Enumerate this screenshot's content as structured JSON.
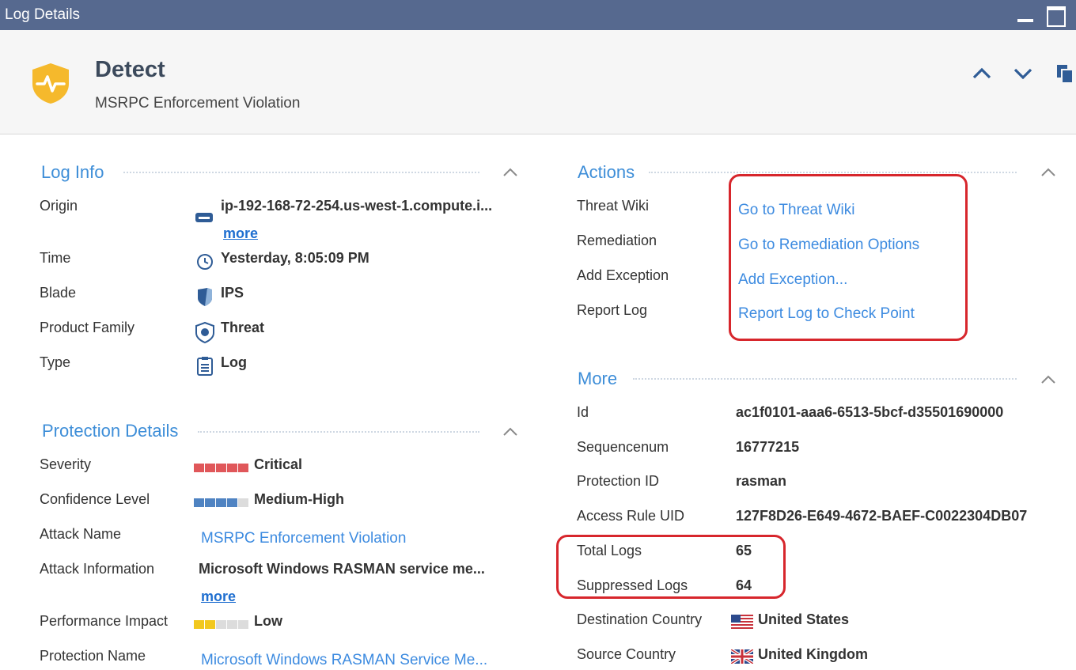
{
  "window": {
    "title": "Log Details"
  },
  "header": {
    "title": "Detect",
    "subtitle": "MSRPC Enforcement Violation"
  },
  "log_info": {
    "title": "Log Info",
    "rows": [
      {
        "label": "Origin",
        "value": "ip-192-168-72-254.us-west-1.compute.i...",
        "more": "more"
      },
      {
        "label": "Time",
        "value": "Yesterday, 8:05:09 PM"
      },
      {
        "label": "Blade",
        "value": "IPS"
      },
      {
        "label": "Product Family",
        "value": "Threat"
      },
      {
        "label": "Type",
        "value": "Log"
      }
    ]
  },
  "protection": {
    "title": "Protection Details",
    "severity": {
      "label": "Severity",
      "value": "Critical",
      "level": 1.0,
      "color": "#e0575a"
    },
    "confidence": {
      "label": "Confidence Level",
      "value": "Medium-High",
      "level": 0.8,
      "color": "#4f83c2"
    },
    "attack_name": {
      "label": "Attack Name",
      "value": "MSRPC Enforcement Violation"
    },
    "attack_info": {
      "label": "Attack Information",
      "value": "Microsoft Windows RASMAN service me...",
      "more": "more"
    },
    "performance": {
      "label": "Performance Impact",
      "value": "Low",
      "level": 0.4,
      "color": "#f2c81e"
    },
    "protection_name": {
      "label": "Protection Name",
      "value": "Microsoft Windows RASMAN Service Me..."
    }
  },
  "actions": {
    "title": "Actions",
    "rows": [
      {
        "label": "Threat Wiki",
        "link": "Go to Threat Wiki"
      },
      {
        "label": "Remediation",
        "link": "Go to Remediation Options"
      },
      {
        "label": "Add Exception",
        "link": "Add Exception..."
      },
      {
        "label": "Report Log",
        "link": "Report Log to Check Point"
      }
    ]
  },
  "more_section": {
    "title": "More",
    "rows": [
      {
        "label": "Id",
        "value": "ac1f0101-aaa6-6513-5bcf-d35501690000"
      },
      {
        "label": "Sequencenum",
        "value": "16777215"
      },
      {
        "label": "Protection ID",
        "value": "rasman"
      },
      {
        "label": "Access Rule UID",
        "value": "127F8D26-E649-4672-BAEF-C0022304DB07"
      },
      {
        "label": "Total Logs",
        "value": "65"
      },
      {
        "label": "Suppressed Logs",
        "value": "64"
      },
      {
        "label": "Destination Country",
        "value": "United States"
      },
      {
        "label": "Source Country",
        "value": "United Kingdom"
      }
    ]
  },
  "colors": {
    "accent": "#3e8ed8",
    "titlebar": "#56698f",
    "highlight": "#d7262c",
    "shield": "#f5b92c"
  }
}
